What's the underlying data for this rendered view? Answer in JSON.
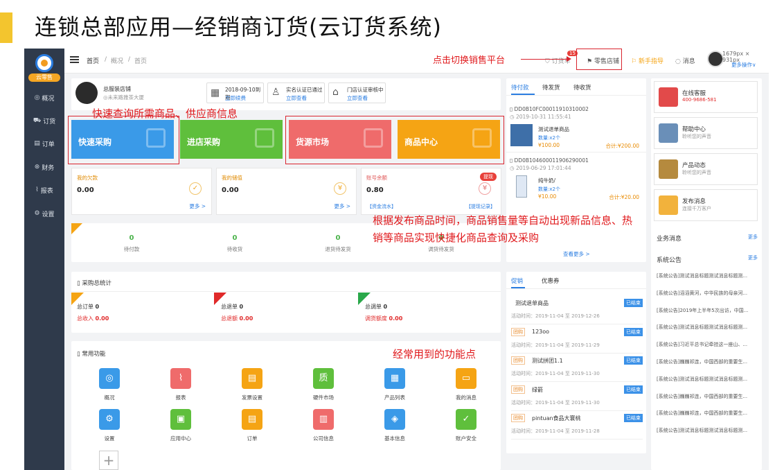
{
  "slide": {
    "title": "连锁总部应用—经销商订货(云订货系统)"
  },
  "sidebar": {
    "badge": "云零售",
    "items": [
      {
        "icon": "◎",
        "label": "概况"
      },
      {
        "icon": "⛟",
        "label": "订货"
      },
      {
        "icon": "▤",
        "label": "订单"
      },
      {
        "icon": "⊛",
        "label": "财务"
      },
      {
        "icon": "⌇",
        "label": "报表"
      },
      {
        "icon": "⚙",
        "label": "设置"
      }
    ]
  },
  "topbar": {
    "crumbs": [
      "首页",
      "/",
      "概况",
      "/",
      "首页"
    ],
    "cart_label": "订货车",
    "cart_badge": "15",
    "retail_store": "零售店铺",
    "guide": "新手指导",
    "messages": "消息",
    "screen_size": "1679px × 931px",
    "more_ops": "更多操作∨"
  },
  "annotations": {
    "switch": "点击切换销售平台",
    "search": "快速查询所需商品、供应商信息",
    "auto": "根据发布商品时间，商品销售量等自动出现新品信息、热销等商品实现快捷化商品查询及采购",
    "common": "经常用到的功能点"
  },
  "store": {
    "name": "总服装店铺",
    "address": "◎未来路雅茶大厦"
  },
  "status": [
    {
      "line1": "2018-09-10到期",
      "line2": "立即续费"
    },
    {
      "line1": "实名认证已通过",
      "line2": "立即查看"
    },
    {
      "line1": "门店认证审核中",
      "line2": "立即查看"
    }
  ],
  "tiles": [
    {
      "label": "快速采购",
      "color": "#3a9ae8"
    },
    {
      "label": "进店采购",
      "color": "#5fbf3c"
    },
    {
      "label": "货源市场",
      "color": "#ef6b6b"
    },
    {
      "label": "商品中心",
      "color": "#f5a414"
    }
  ],
  "balances": [
    {
      "title": "我的欠款",
      "value": "0.00",
      "icon": "✓",
      "more": "更多 >"
    },
    {
      "title": "我的储值",
      "value": "0.00",
      "icon": "¥",
      "more": "更多 >"
    },
    {
      "title": "账号余额",
      "value": "0.80",
      "icon": "¥",
      "badge": "提现",
      "link1": "【资金流水】",
      "link2": "【提现记录】"
    }
  ],
  "counts": [
    {
      "value": "0",
      "label": "待付款"
    },
    {
      "value": "0",
      "label": "待收货"
    },
    {
      "value": "0",
      "label": "退货待发货"
    },
    {
      "value": "0",
      "label": "调货待发货"
    }
  ],
  "purchase_stats": {
    "title": "采购总统计",
    "groups": [
      {
        "l1": "总订单",
        "v1": "0",
        "l2": "总收入",
        "v2": "0.00"
      },
      {
        "l1": "总退单",
        "v1": "0",
        "l2": "总退额",
        "v2": "0.00"
      },
      {
        "l1": "总调单",
        "v1": "0",
        "l2": "调货额度",
        "v2": "0.00"
      }
    ]
  },
  "functions": {
    "title": "常用功能",
    "items": [
      {
        "label": "概况",
        "icon": "◎",
        "color": "#3a9ae8"
      },
      {
        "label": "报表",
        "icon": "⌇",
        "color": "#ef6b6b"
      },
      {
        "label": "发票设置",
        "icon": "▤",
        "color": "#f5a414"
      },
      {
        "label": "硬件市场",
        "icon": "质",
        "color": "#5fbf3c"
      },
      {
        "label": "产品列表",
        "icon": "▦",
        "color": "#3a9ae8"
      },
      {
        "label": "我的消息",
        "icon": "▭",
        "color": "#f5a414"
      },
      {
        "label": "设置",
        "icon": "⚙",
        "color": "#3a9ae8"
      },
      {
        "label": "应用中心",
        "icon": "▣",
        "color": "#5fbf3c"
      },
      {
        "label": "订单",
        "icon": "▤",
        "color": "#f5a414"
      },
      {
        "label": "公司信息",
        "icon": "▥",
        "color": "#ef6b6b"
      },
      {
        "label": "基本信息",
        "icon": "◈",
        "color": "#3a9ae8"
      },
      {
        "label": "账户安全",
        "icon": "✓",
        "color": "#5fbf3c"
      }
    ],
    "add": "+"
  },
  "orders": {
    "tabs": [
      "待付款",
      "待发货",
      "待收货"
    ],
    "list": [
      {
        "id": "DD0B10FC00011910310002",
        "time": "2019-10-31 11:55:41",
        "name": "测试退单商品",
        "qty": "数量:x2个",
        "price": "¥100.00",
        "total": "合计:¥200.00"
      },
      {
        "id": "DD0B104600011906290001",
        "time": "2019-06-29 17:01:44",
        "name": "纯牛奶/",
        "qty": "数量:x2个",
        "price": "¥10.00",
        "total": "合计:¥20.00"
      }
    ],
    "more": "查看更多 >"
  },
  "promos": {
    "tabs": [
      "促销",
      "优惠券"
    ],
    "list": [
      {
        "tag": "",
        "name": "测试退单商品",
        "status": "已结束",
        "time": "活动时间：2019-11-04 至 2019-12-26"
      },
      {
        "tag": "团购",
        "name": "123oo",
        "status": "已结束",
        "time": "活动时间：2019-11-04 至 2019-11-29"
      },
      {
        "tag": "团购",
        "name": "测试拼团1.1",
        "status": "已结束",
        "time": "活动时间：2019-11-04 至 2019-11-30"
      },
      {
        "tag": "团购",
        "name": "绿箭",
        "status": "已结束",
        "time": "活动时间：2019-11-04 至 2019-11-30"
      },
      {
        "tag": "团购",
        "name": "pintuan食品大寰桃",
        "status": "已结束",
        "time": "活动时间：2019-11-04 至 2019-11-28"
      }
    ]
  },
  "right": {
    "boxes": [
      {
        "t1": "在线客服",
        "t2": "400-9686-581",
        "color": "#e24a4a"
      },
      {
        "t1": "帮助中心",
        "t2": "聆听您的声音",
        "color": "#6a8fb8"
      },
      {
        "t1": "产品动态",
        "t2": "聆听您的声音",
        "color": "#b58a3e"
      },
      {
        "t1": "发布消息",
        "t2": "连接千万客户",
        "color": "#f2b23c"
      }
    ],
    "biz_title": "业务消息",
    "sys_title": "系统公告",
    "more": "更多",
    "notices": [
      "[系统公告]测试消息标题测试消息标题测...",
      "[系统公告]滔滔黄河，中华民族的母亲河...",
      "[系统公告]2019年上半年5次出访，中国...",
      "[系统公告]测试消息标题测试消息标题测...",
      "[系统公告]习近平总书记牵挂这一座山、...",
      "[系统公告]巍巍祁连，中国西部的重要生...",
      "[系统公告]测试消息标题测试消息标题测...",
      "[系统公告]巍巍祁连，中国西部的重要生...",
      "[系统公告]巍巍祁连，中国西部的重要生...",
      "[系统公告]测试消息标题测试消息标题测..."
    ]
  }
}
